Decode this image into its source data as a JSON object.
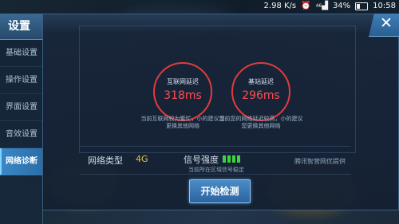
{
  "status_bar": {
    "network_speed": "2.98 K/s",
    "alarm_icon": "alarm-clock-icon",
    "signal_label": "46",
    "battery_percent": "34%",
    "time": "10:58"
  },
  "sidebar": {
    "title": "设置",
    "items": [
      {
        "label": "基础设置",
        "active": false
      },
      {
        "label": "操作设置",
        "active": false
      },
      {
        "label": "界面设置",
        "active": false
      },
      {
        "label": "音效设置",
        "active": false
      },
      {
        "label": "网络诊断",
        "active": true
      }
    ]
  },
  "diagnostics": {
    "internet_latency": {
      "label": "互联网延迟",
      "value": "318ms",
      "note": "当前互联网较为繁忙，小的建议您更换其他网络"
    },
    "base_station_latency": {
      "label": "基站延迟",
      "value": "296ms",
      "note": "当前您的网络延迟较高，小的建议您更换其他网络"
    },
    "network_type_label": "网络类型",
    "network_type_value": "4G",
    "signal_strength_label": "信号强度",
    "signal_strength_bars": 4,
    "signal_note": "当前所在区域信号稳定",
    "provider": "腾讯智营网优提供"
  },
  "actions": {
    "start_label": "开始检测",
    "close_icon": "close-icon"
  },
  "colors": {
    "latency_ring": "#e23b3b",
    "latency_value": "#ff4d4d",
    "network_type": "#e8c24a",
    "signal_bar": "#3ed43e",
    "active_nav": "#3a87c5"
  }
}
